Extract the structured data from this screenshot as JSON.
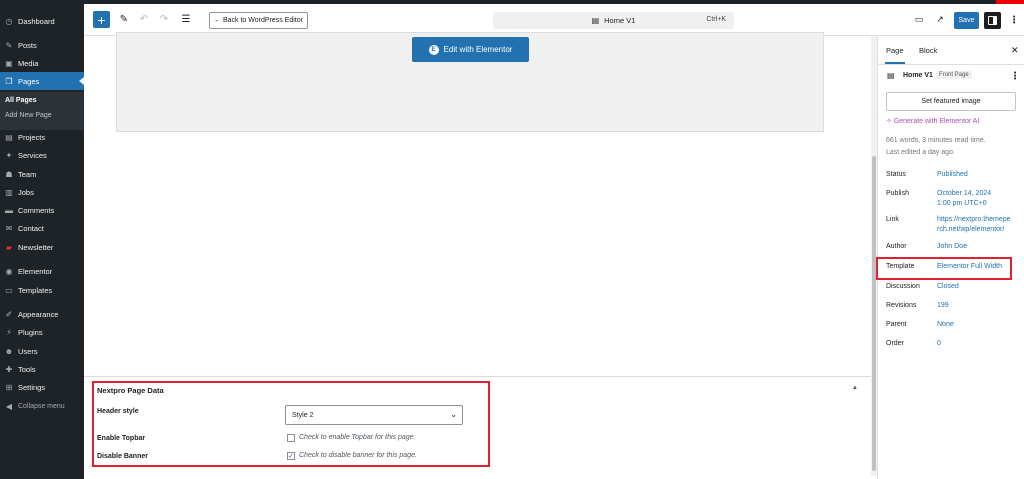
{
  "sidebar": {
    "items": [
      {
        "label": "Dashboard",
        "icon": "dashboard-icon",
        "glyph": "◷"
      },
      {
        "label": "Posts",
        "icon": "pin-icon",
        "glyph": "✎"
      },
      {
        "label": "Media",
        "icon": "media-icon",
        "glyph": "▣"
      },
      {
        "label": "Pages",
        "icon": "pages-icon",
        "glyph": "❐"
      },
      {
        "label": "Projects",
        "icon": "projects-icon",
        "glyph": "▤"
      },
      {
        "label": "Services",
        "icon": "services-icon",
        "glyph": "✦"
      },
      {
        "label": "Team",
        "icon": "team-icon",
        "glyph": "☗"
      },
      {
        "label": "Jobs",
        "icon": "jobs-icon",
        "glyph": "▥"
      },
      {
        "label": "Comments",
        "icon": "comments-icon",
        "glyph": "▬"
      },
      {
        "label": "Contact",
        "icon": "mail-icon",
        "glyph": "✉"
      },
      {
        "label": "Newsletter",
        "icon": "newsletter-icon",
        "glyph": "▰"
      },
      {
        "label": "Elementor",
        "icon": "elementor-icon",
        "glyph": "◉"
      },
      {
        "label": "Templates",
        "icon": "folder-icon",
        "glyph": "▭"
      },
      {
        "label": "Appearance",
        "icon": "brush-icon",
        "glyph": "✐"
      },
      {
        "label": "Plugins",
        "icon": "plug-icon",
        "glyph": "⚡"
      },
      {
        "label": "Users",
        "icon": "user-icon",
        "glyph": "☻"
      },
      {
        "label": "Tools",
        "icon": "wrench-icon",
        "glyph": "✚"
      },
      {
        "label": "Settings",
        "icon": "settings-icon",
        "glyph": "⊞"
      }
    ],
    "submenu": {
      "all_pages": "All Pages",
      "add_new": "Add New Page"
    },
    "collapse": "Collapse menu"
  },
  "toolbar": {
    "back_label": "← Back to WordPress Editor",
    "doc_title": "Home V1",
    "shortcut": "Ctrl+K",
    "save_label": "Save"
  },
  "canvas": {
    "elementor_button": "Edit with Elementor",
    "elementor_glyph": "E"
  },
  "meta_box": {
    "title": "Nextpro Page Data",
    "header_style_label": "Header style",
    "header_style_value": "Style 2",
    "topbar_label": "Enable Topbar",
    "topbar_desc": "Check to enable Topbar for this page.",
    "topbar_checked": false,
    "banner_label": "Disable Banner",
    "banner_desc": "Check to disable banner for this page.",
    "banner_checked": true
  },
  "panel": {
    "tab_page": "Page",
    "tab_block": "Block",
    "page_title": "Home V1",
    "page_badge": "Front Page",
    "featured_image": "Set featured image",
    "ai_link": "Generate with Elementor AI",
    "stats": "661 words, 3 minutes read time.",
    "last_edited": "Last edited a day ago.",
    "rows": {
      "status": {
        "label": "Status",
        "value": "Published"
      },
      "publish": {
        "label": "Publish",
        "value1": "October 14, 2024",
        "value2": "1:00 pm UTC+0"
      },
      "link": {
        "label": "Link",
        "value1": "https://nextpro.themepe",
        "value2": "rch.net/wp/elementor/"
      },
      "author": {
        "label": "Author",
        "value": "John Doe"
      },
      "template": {
        "label": "Template",
        "value": "Elementor Full Width"
      },
      "discussion": {
        "label": "Discussion",
        "value": "Closed"
      },
      "revisions": {
        "label": "Revisions",
        "value": "199"
      },
      "parent": {
        "label": "Parent",
        "value": "None"
      },
      "order": {
        "label": "Order",
        "value": "0"
      }
    }
  },
  "colors": {
    "accent": "#2271b1",
    "highlight": "#e0212e",
    "admin_bg": "#1d2327"
  }
}
